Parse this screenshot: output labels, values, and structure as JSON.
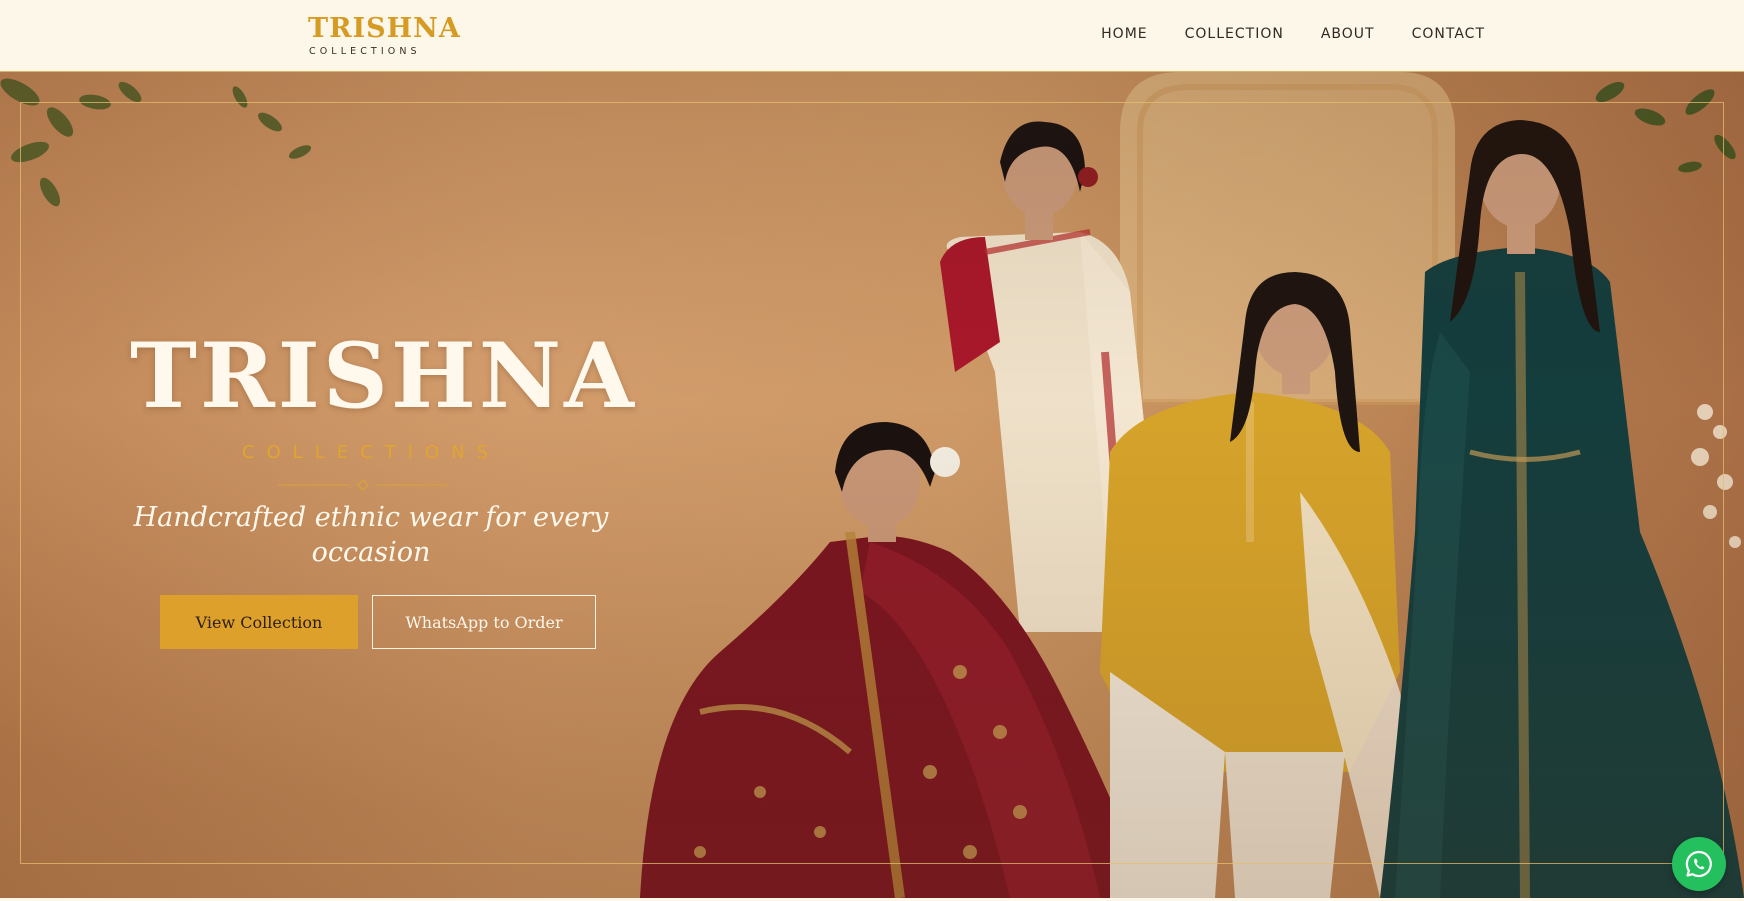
{
  "header": {
    "logo_title": "TRISHNA",
    "logo_subtitle": "COLLECTIONS",
    "nav": [
      {
        "label": "HOME"
      },
      {
        "label": "COLLECTION"
      },
      {
        "label": "ABOUT"
      },
      {
        "label": "CONTACT"
      }
    ]
  },
  "hero": {
    "title": "TRISHNA",
    "subtitle": "COLLECTIONS",
    "tagline_line1": "Handcrafted ethnic wear for every",
    "tagline_line2": "occasion",
    "primary_button": "View Collection",
    "secondary_button": "WhatsApp to Order",
    "image_icon": "models-ethnic-wear-photo"
  },
  "floating": {
    "whatsapp_icon": "whatsapp-icon"
  },
  "colors": {
    "brand_gold": "#dda02a",
    "header_bg": "#fdf7ea",
    "whatsapp_green": "#25c05e",
    "cream_text": "#fff8ec"
  }
}
